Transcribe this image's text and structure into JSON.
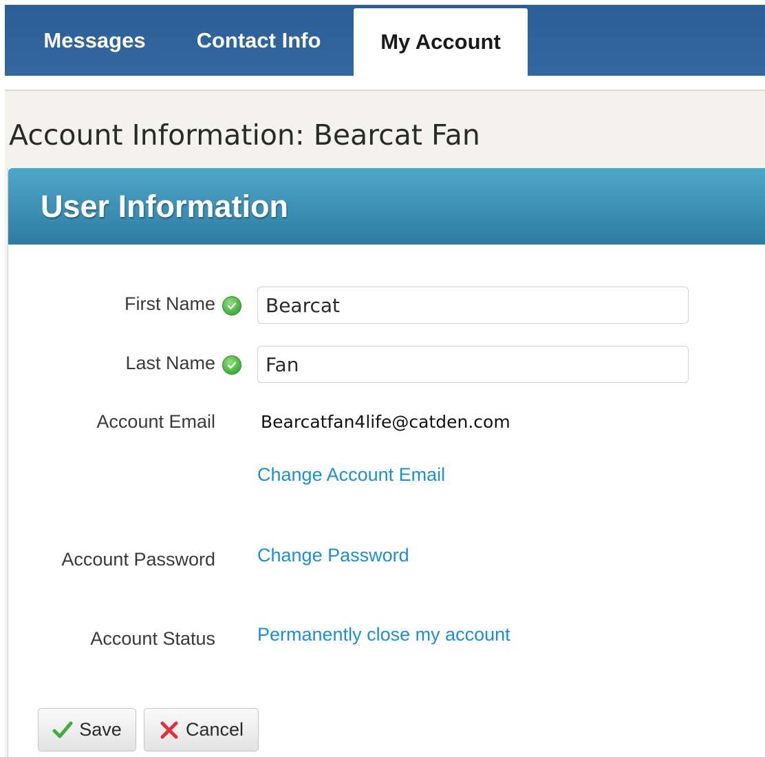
{
  "tabs": {
    "messages": "Messages",
    "contact_info": "Contact Info",
    "my_account": "My Account",
    "active": "My Account"
  },
  "page": {
    "title": "Account Information: Bearcat Fan"
  },
  "panel": {
    "title": "User Information"
  },
  "form": {
    "first_name": {
      "label": "First Name",
      "value": "Bearcat",
      "icon": "check-icon"
    },
    "last_name": {
      "label": "Last Name",
      "value": "Fan",
      "icon": "check-icon"
    },
    "account_email": {
      "label": "Account Email",
      "value": "Bearcatfan4life@catden.com",
      "change_link": "Change Account Email"
    },
    "account_password": {
      "label": "Account Password",
      "change_link": "Change Password"
    },
    "account_status": {
      "label": "Account Status",
      "close_link": "Permanently close my account"
    }
  },
  "buttons": {
    "save": {
      "label": "Save",
      "icon": "checkmark-icon"
    },
    "cancel": {
      "label": "Cancel",
      "icon": "x-icon"
    }
  },
  "colors": {
    "tabbar": "#2f6399",
    "panel_header": "#3a8fb7",
    "link": "#1d8fd1",
    "valid_check": "#3fae3a",
    "cancel_x": "#e0303a"
  }
}
